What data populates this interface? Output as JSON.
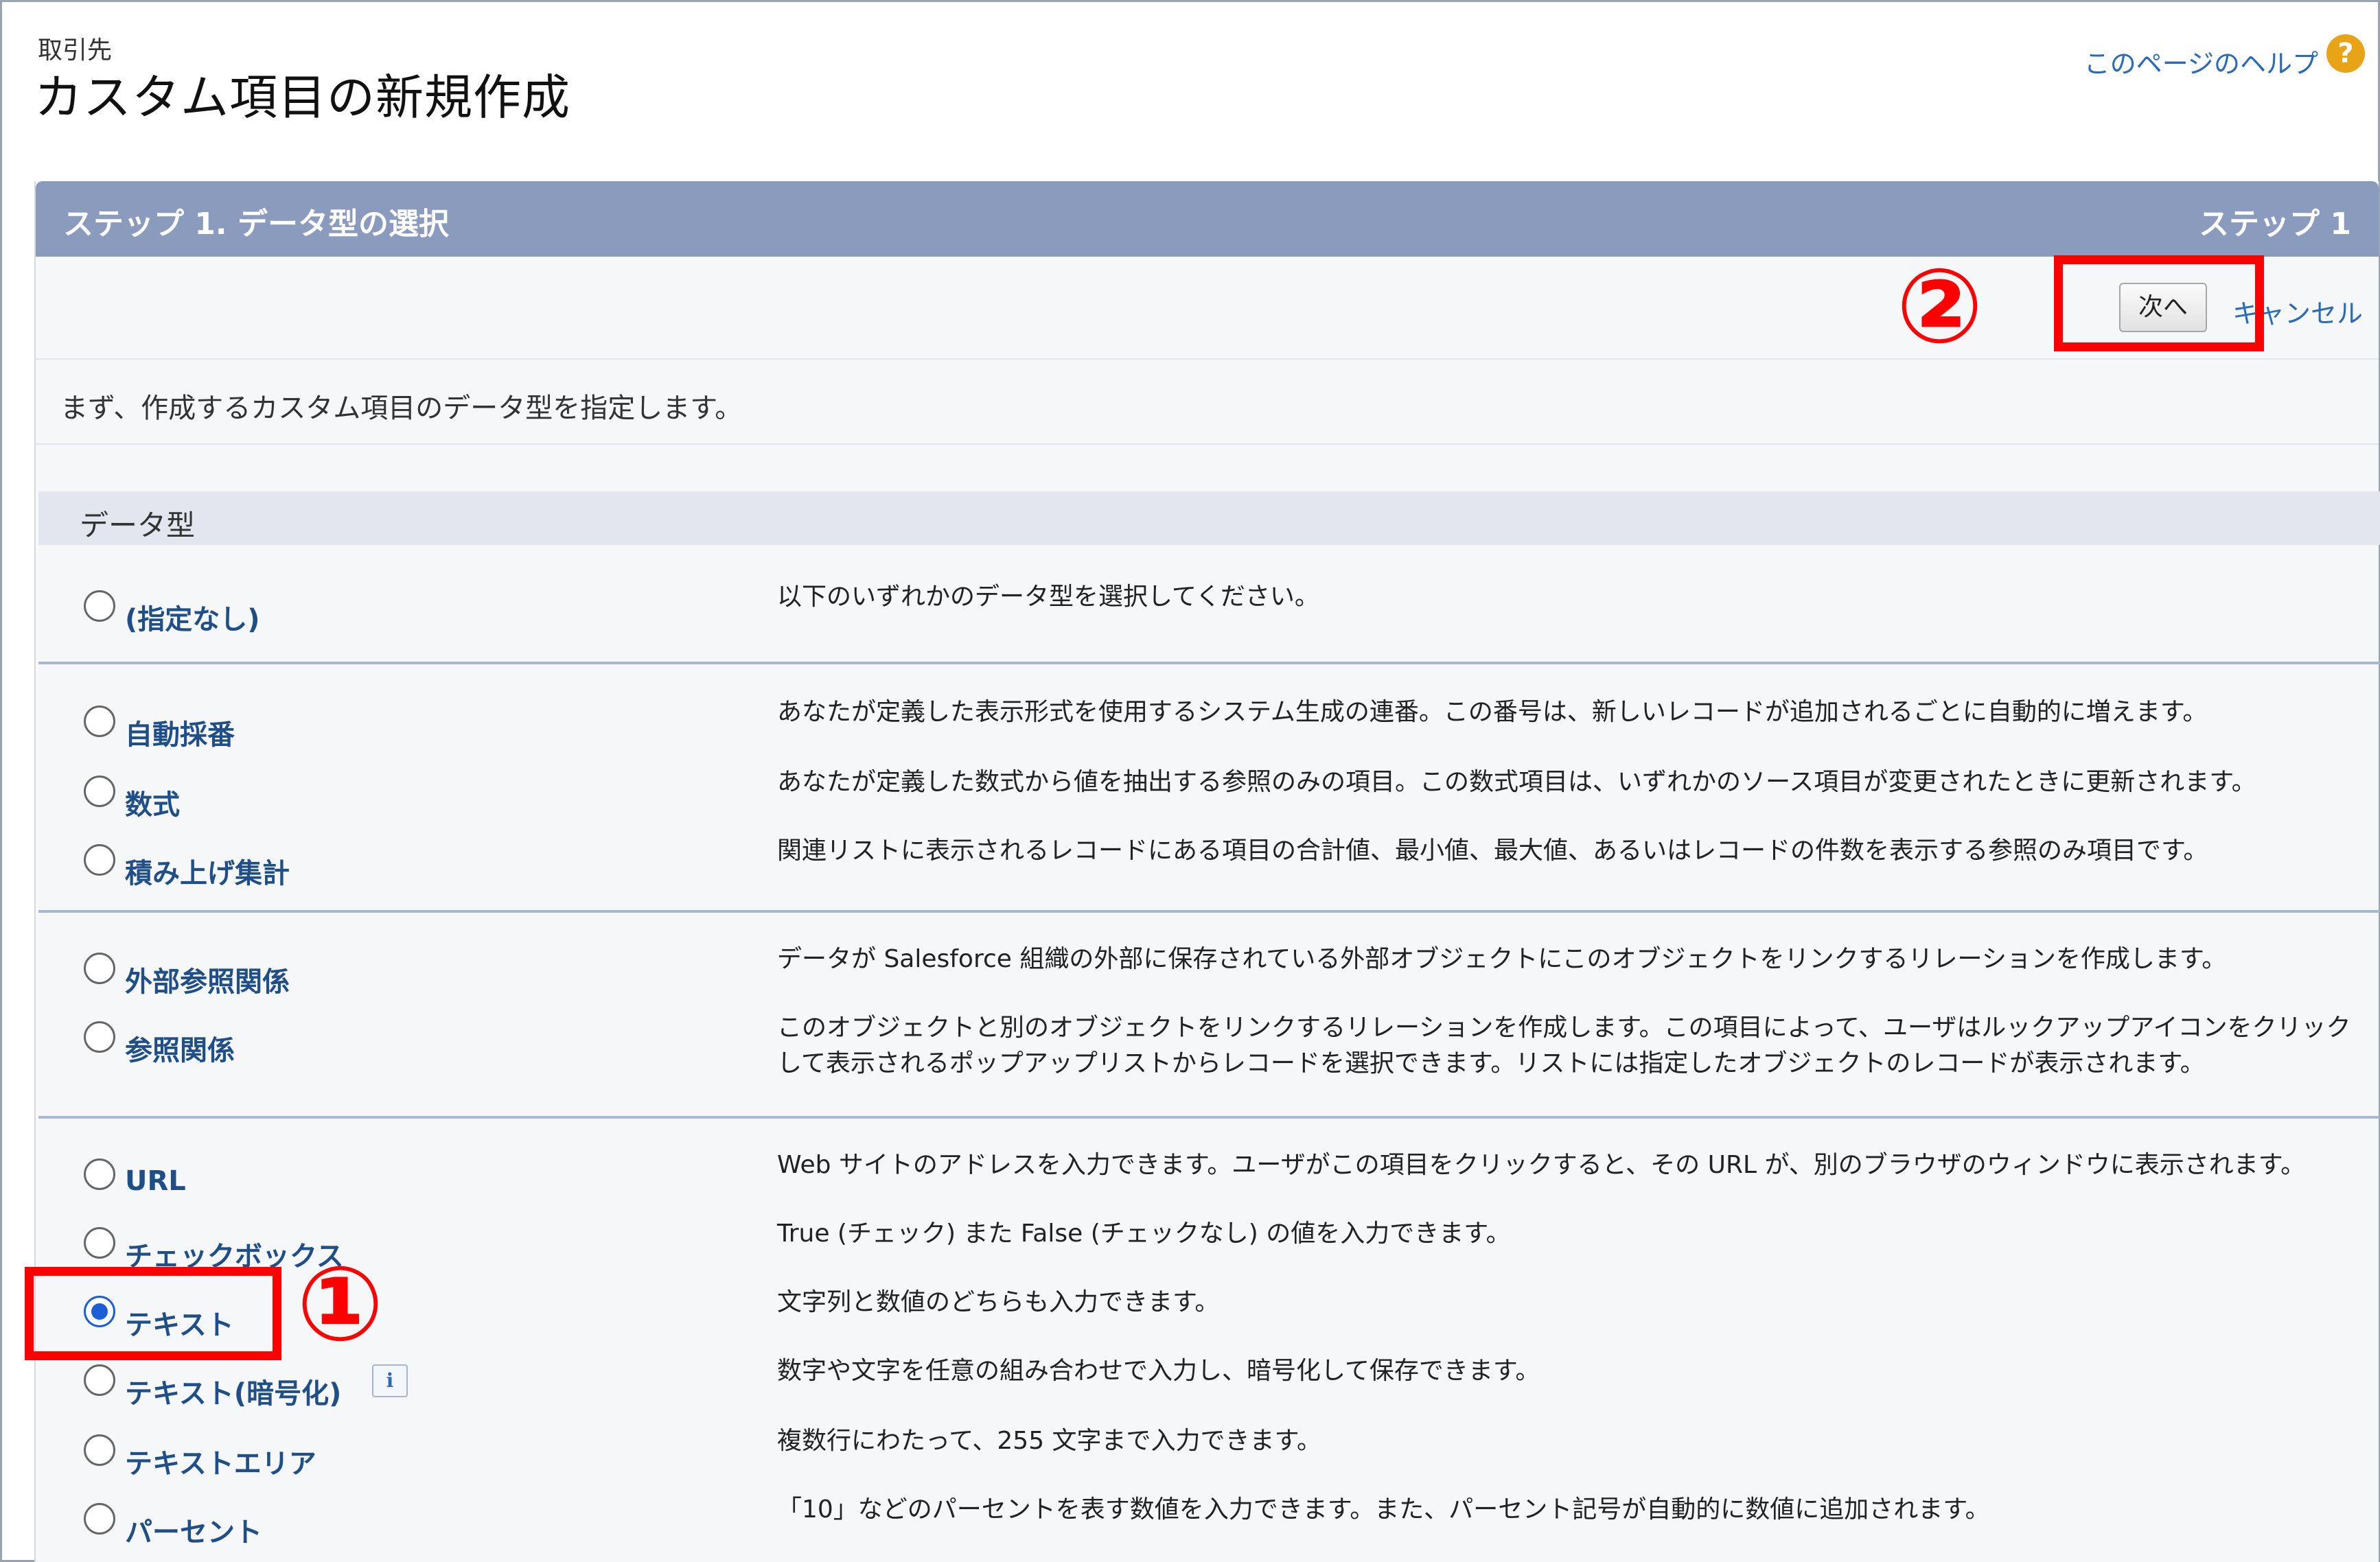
{
  "header": {
    "object_name": "取引先",
    "title": "カスタム項目の新規作成",
    "help_link": "このページのヘルプ",
    "help_icon": "?"
  },
  "panel": {
    "title": "ステップ 1. データ型の選択",
    "step": "ステップ 1",
    "next_button": "次へ",
    "cancel_link": "キャンセル",
    "intro": "まず、作成するカスタム項目のデータ型を指定します。",
    "section_label": "データ型"
  },
  "options": [
    {
      "label": "(指定なし)",
      "desc": "以下のいずれかのデータ型を選択してください。",
      "checked": false
    },
    {
      "label": "自動採番",
      "desc": "あなたが定義した表示形式を使用するシステム生成の連番。この番号は、新しいレコードが追加されるごとに自動的に増えます。",
      "checked": false
    },
    {
      "label": "数式",
      "desc": "あなたが定義した数式から値を抽出する参照のみの項目。この数式項目は、いずれかのソース項目が変更されたときに更新されます。",
      "checked": false
    },
    {
      "label": "積み上げ集計",
      "desc": "関連リストに表示されるレコードにある項目の合計値、最小値、最大値、あるいはレコードの件数を表示する参照のみ項目です。",
      "checked": false
    },
    {
      "label": "外部参照関係",
      "desc": "データが Salesforce 組織の外部に保存されている外部オブジェクトにこのオブジェクトをリンクするリレーションを作成します。",
      "checked": false
    },
    {
      "label": "参照関係",
      "desc": "このオブジェクトと別のオブジェクトをリンクするリレーションを作成します。この項目によって、ユーザはルックアップアイコンをクリックして表示されるポップアップリストからレコードを選択できます。リストには指定したオブジェクトのレコードが表示されます。",
      "checked": false
    },
    {
      "label": "URL",
      "desc": "Web サイトのアドレスを入力できます。ユーザがこの項目をクリックすると、その URL が、別のブラウザのウィンドウに表示されます。",
      "checked": false
    },
    {
      "label": "チェックボックス",
      "desc": "True (チェック) また False (チェックなし) の値を入力できます。",
      "checked": false
    },
    {
      "label": "テキスト",
      "desc": "文字列と数値のどちらも入力できます。",
      "checked": true
    },
    {
      "label": "テキスト(暗号化)",
      "desc": "数字や文字を任意の組み合わせで入力し、暗号化して保存できます。",
      "checked": false,
      "info_badge": "i"
    },
    {
      "label": "テキストエリア",
      "desc": "複数行にわたって、255 文字まで入力できます。",
      "checked": false
    },
    {
      "label": "パーセント",
      "desc": "「10」などのパーセントを表す数値を入力できます。また、パーセント記号が自動的に数値に追加されます。",
      "checked": false
    }
  ],
  "annotations": {
    "marker1": "①",
    "marker2": "②",
    "color": "#ff0000"
  }
}
